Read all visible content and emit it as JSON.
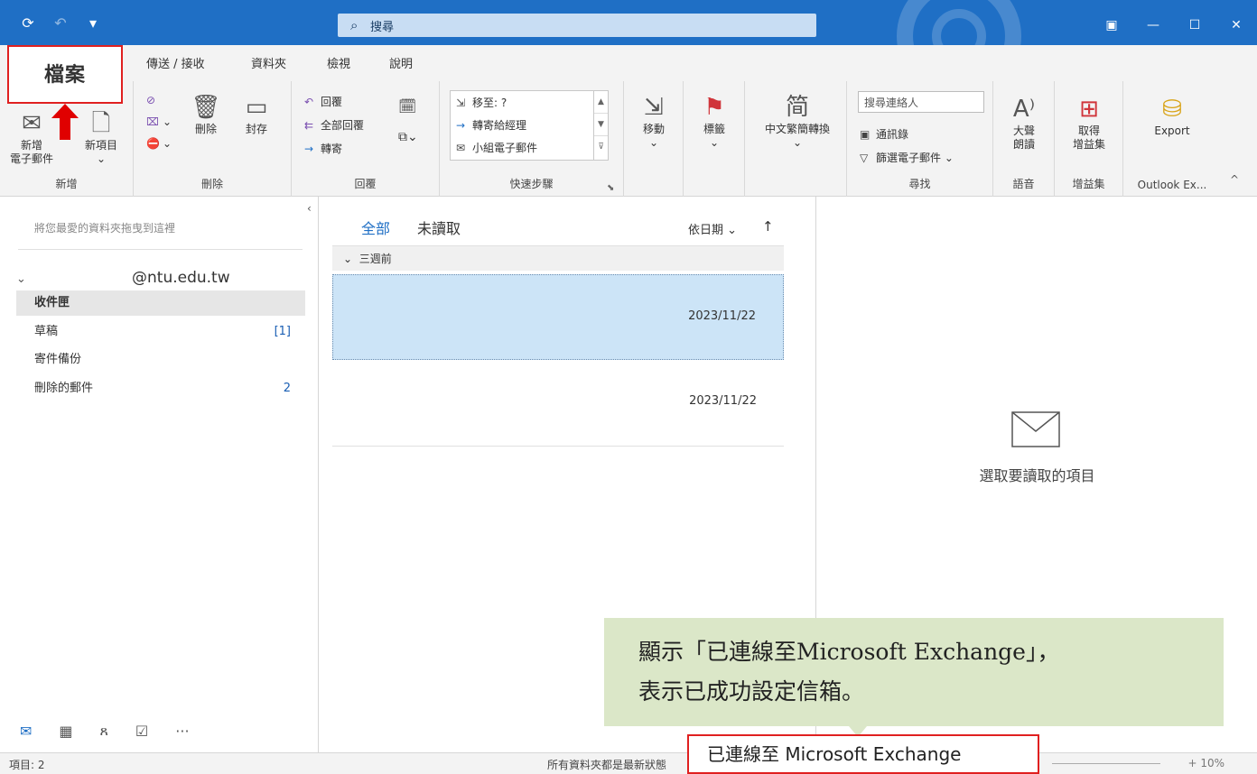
{
  "titlebar": {
    "search_placeholder": "搜尋",
    "colors": {
      "accent": "#1f6fc5"
    }
  },
  "tabs": {
    "file": "檔案",
    "send_receive": "傳送 / 接收",
    "folder": "資料夾",
    "view": "檢視",
    "help": "說明"
  },
  "ribbon": {
    "new": {
      "new_email": "新增\n電子郵件",
      "new_email_line1": "新增",
      "new_email_line2": "電子郵件",
      "new_item": "新項目",
      "label": "新增"
    },
    "delete": {
      "delete": "刪除",
      "archive": "封存",
      "label": "刪除"
    },
    "respond": {
      "reply": "回覆",
      "reply_all": "全部回覆",
      "forward": "轉寄",
      "label": "回覆"
    },
    "quick_steps": {
      "items": [
        "移至: ?",
        "轉寄給經理",
        "小組電子郵件"
      ],
      "label": "快速步驟"
    },
    "move": "移動",
    "tags": "標籤",
    "chinese_conversion": "中文繁簡轉換",
    "find": {
      "search_people": "搜尋連絡人",
      "address_book": "通訊錄",
      "filter_email": "篩選電子郵件",
      "label": "尋找"
    },
    "speech": {
      "read_aloud_1": "大聲",
      "read_aloud_2": "朗讀",
      "label": "語音"
    },
    "addins": {
      "get_1": "取得",
      "get_2": "增益集",
      "label": "增益集"
    },
    "outlook_ex": {
      "export": "Export",
      "label": "Outlook Ex..."
    }
  },
  "folder_pane": {
    "favorites_hint": "將您最愛的資料夾拖曳到這裡",
    "account": "@ntu.edu.tw",
    "folders": [
      {
        "name": "收件匣",
        "count": ""
      },
      {
        "name": "草稿",
        "count": "[1]"
      },
      {
        "name": "寄件備份",
        "count": ""
      },
      {
        "name": "刪除的郵件",
        "count": "2"
      }
    ]
  },
  "message_list": {
    "tab_all": "全部",
    "tab_unread": "未讀取",
    "sort_by": "依日期",
    "group_header": "三週前",
    "messages": [
      {
        "date": "2023/11/22"
      },
      {
        "date": "2023/11/22"
      }
    ]
  },
  "reading_pane": {
    "hint": "選取要讀取的項目"
  },
  "callout": {
    "line1": "顯示「已連線至Microsoft Exchange」，",
    "line2": "表示已成功設定信箱。"
  },
  "status": {
    "items": "項目: 2",
    "up_to_date": "所有資料夾都是最新狀態",
    "connected": "已連線至 Microsoft Exchange",
    "zoom": "10%"
  }
}
